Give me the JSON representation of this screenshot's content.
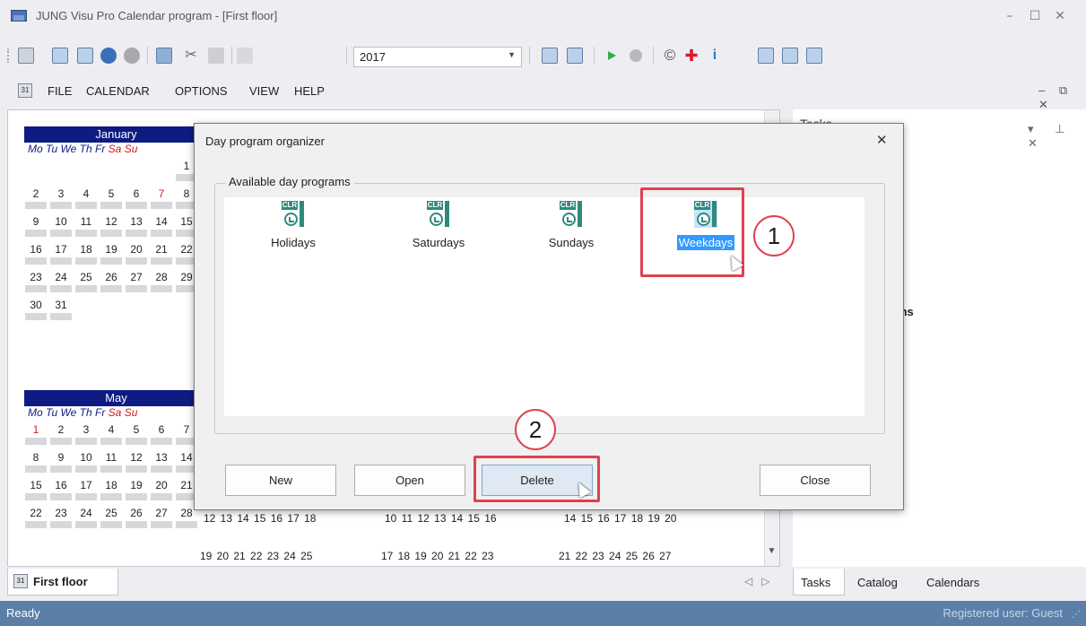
{
  "window": {
    "title": "JUNG Visu Pro Calendar program - [First floor]",
    "controls": [
      "–",
      "☐",
      "✕"
    ]
  },
  "toolbar": {
    "year_value": "2017",
    "icons": [
      "new-icon",
      "calendar-31-icon",
      "calendar-edit-icon",
      "clock-icon",
      "clock-gray-icon",
      "calendar-tool-icon",
      "cut-icon",
      "paste-icon",
      "paste-gray-icon",
      "list-icon",
      "calendar-list-icon",
      "play-icon",
      "stop-icon",
      "copyright-icon",
      "add-icon",
      "info-icon",
      "view1-icon",
      "view2-icon",
      "view3-icon"
    ]
  },
  "menu": {
    "items": [
      "FILE",
      "CALENDAR",
      "OPTIONS",
      "VIEW",
      "HELP"
    ],
    "right_controls": "–  ⧉  ✕"
  },
  "calendar": {
    "dow": [
      "Mo",
      "Tu",
      "We",
      "Th",
      "Fr",
      "Sa",
      "Su"
    ],
    "january": {
      "name": "January",
      "weeks": [
        [
          "",
          "",
          "",
          "",
          "",
          "",
          "1"
        ],
        [
          "2",
          "3",
          "4",
          "5",
          "6",
          "7",
          "8"
        ],
        [
          "9",
          "10",
          "11",
          "12",
          "13",
          "14",
          "15"
        ],
        [
          "16",
          "17",
          "18",
          "19",
          "20",
          "21",
          "22"
        ],
        [
          "23",
          "24",
          "25",
          "26",
          "27",
          "28",
          "29"
        ],
        [
          "30",
          "31",
          "",
          "",
          "",
          "",
          ""
        ]
      ]
    },
    "may": {
      "name": "May",
      "weeks": [
        [
          "1",
          "2",
          "3",
          "4",
          "5",
          "6",
          "7"
        ],
        [
          "8",
          "9",
          "10",
          "11",
          "12",
          "13",
          "14"
        ],
        [
          "15",
          "16",
          "17",
          "18",
          "19",
          "20",
          "21"
        ],
        [
          "22",
          "23",
          "24",
          "25",
          "26",
          "27",
          "28"
        ]
      ]
    },
    "lower_rows": {
      "row1": [
        "12 13 14 15 16 17 18",
        "10 11 12 13 14 15 16",
        "14 15 16 17 18 19 20"
      ],
      "row2": [
        "19 20 21 22 23 24 25",
        "17 18 19 20 21 22 23",
        "21 22 23 24 25 26 27"
      ]
    }
  },
  "doc_tab": {
    "label": "First floor"
  },
  "right_panel": {
    "title": "Tasks",
    "fragment": "ms",
    "tabs": [
      "Tasks",
      "Catalog",
      "Calendars"
    ]
  },
  "status": {
    "left": "Ready",
    "right": "Registered user: Guest"
  },
  "dialog": {
    "title": "Day program organizer",
    "group_label": "Available day programs",
    "icon_badge": "CLR",
    "programs": [
      "Holidays",
      "Saturdays",
      "Sundays",
      "Weekdays"
    ],
    "selected_program": "Weekdays",
    "buttons": {
      "new": "New",
      "open": "Open",
      "delete": "Delete",
      "close": "Close"
    }
  },
  "annotations": {
    "step1": "1",
    "step2": "2",
    "highlight_color": "#e0414f"
  },
  "colors": {
    "month_header": "#0e1b82",
    "weekend": "#d01c1c",
    "status_bar": "#5b7fa6",
    "selection": "#3399ff"
  }
}
